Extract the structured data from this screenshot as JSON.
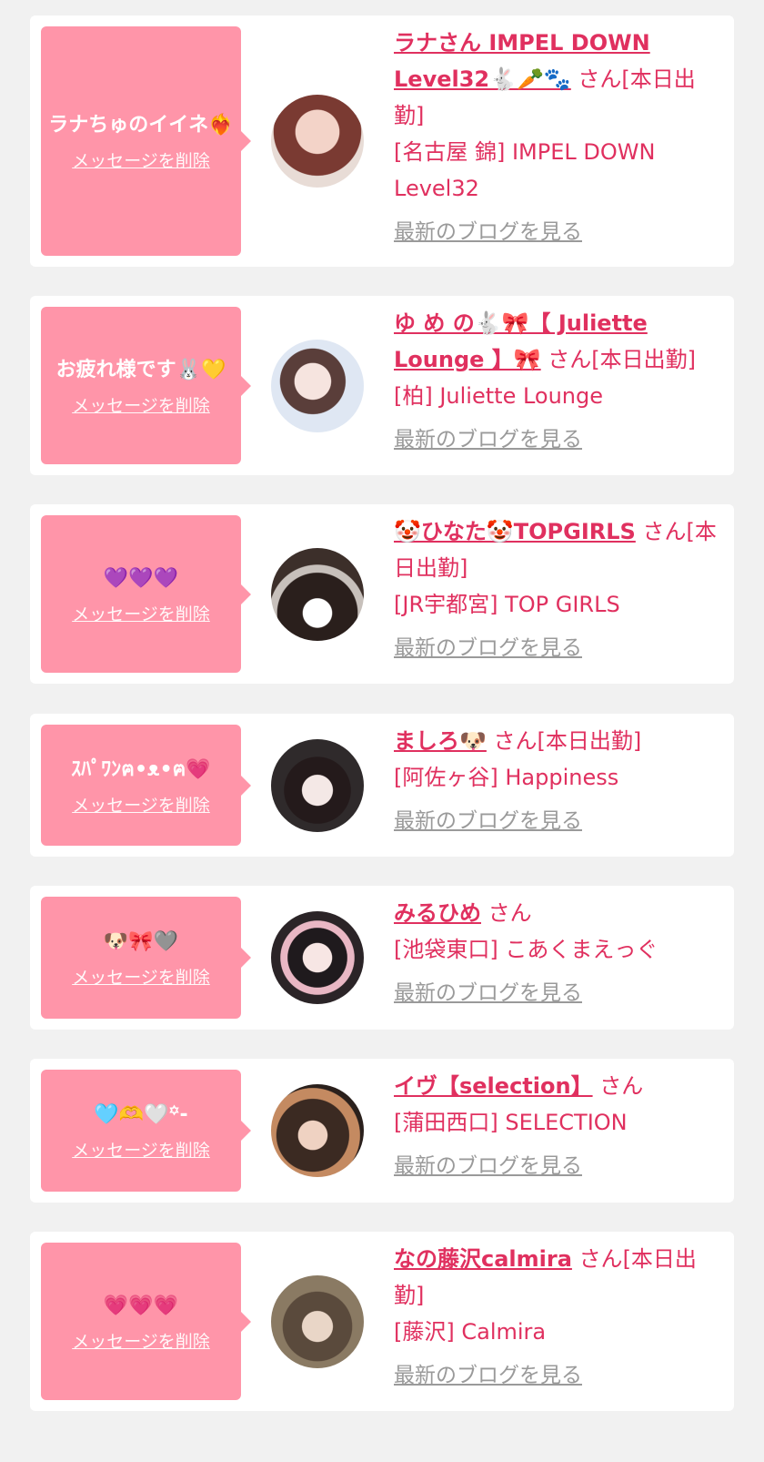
{
  "delete_label": "メッセージを削除",
  "blog_label": "最新のブログを見る",
  "san_label": "さん",
  "shift_label": "[本日出勤]",
  "colors": {
    "accent": "#e0305f",
    "bubble": "#ff95a9",
    "background": "#f1f1f1",
    "muted": "#9a9a9a"
  },
  "entries": [
    {
      "message": "ラナちゅのイイネ❤️‍🔥",
      "name": "ラナさん IMPEL DOWN Level32🐇🥕🐾",
      "shift": true,
      "area_shop": "[名古屋 錦] IMPEL DOWN Level32",
      "avatar_icon": "avatar-photo-icon"
    },
    {
      "message": "お疲れ様です🐰💛",
      "name": "ゆ め の🐇🎀【 Juliette Lounge 】🎀",
      "shift": true,
      "area_shop": "[柏] Juliette Lounge",
      "avatar_icon": "avatar-photo-icon"
    },
    {
      "message": "💜💜💜",
      "name": "🤡ひなた🤡TOPGIRLS",
      "shift": true,
      "area_shop": "[JR宇都宮] TOP GIRLS",
      "avatar_icon": "avatar-photo-icon"
    },
    {
      "message": "ｽﾊﾟﾜﾝฅ•ᴥ•ฅ💗",
      "name": "ましろ🐶",
      "shift": true,
      "area_shop": "[阿佐ヶ谷] Happiness",
      "avatar_icon": "avatar-photo-icon"
    },
    {
      "message": "🐶🎀🩶",
      "name": "みるひめ",
      "shift": false,
      "area_shop": "[池袋東口] こあくまえっぐ",
      "avatar_icon": "avatar-photo-icon"
    },
    {
      "message": "🩵🫶🤍꙳-",
      "name": "イヴ【selection】",
      "shift": false,
      "area_shop": "[蒲田西口] SELECTION",
      "avatar_icon": "avatar-photo-icon"
    },
    {
      "message": "💗💗💗",
      "name": "なの藤沢calmira",
      "shift": true,
      "area_shop": "[藤沢] Calmira",
      "avatar_icon": "avatar-photo-icon"
    }
  ]
}
